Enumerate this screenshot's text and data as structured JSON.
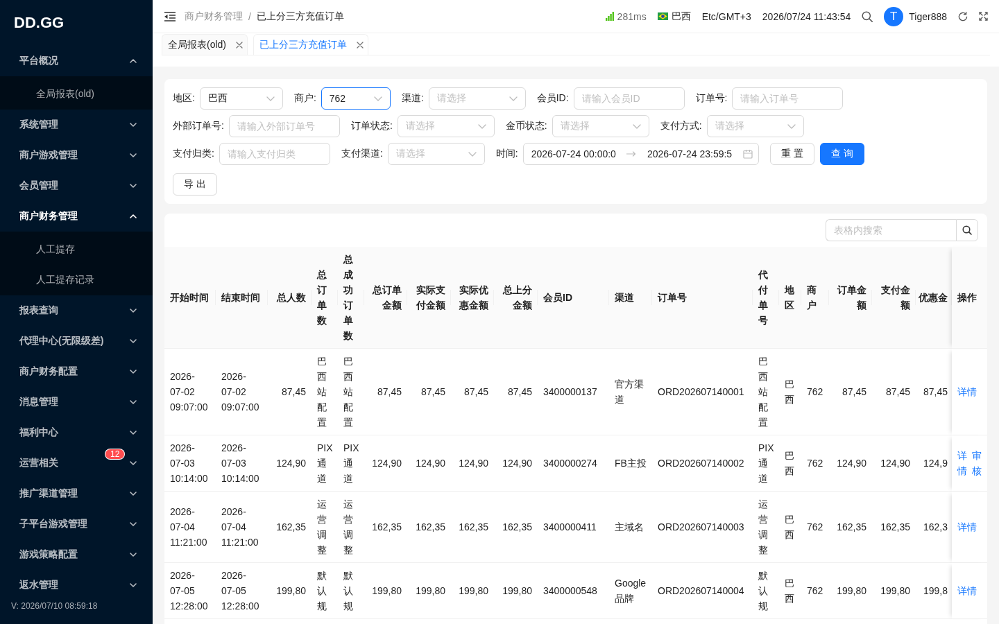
{
  "sidebar": {
    "logo": "DD.GG",
    "menu": [
      {
        "label": "平台概况",
        "expanded": true,
        "selected": false,
        "children": [
          {
            "label": "全局报表(old)",
            "selected": false
          }
        ]
      },
      {
        "label": "系统管理",
        "expanded": false,
        "selected": false
      },
      {
        "label": "商户游戏管理",
        "expanded": false,
        "selected": false
      },
      {
        "label": "会员管理",
        "expanded": false,
        "selected": false
      },
      {
        "label": "商户财务管理",
        "expanded": true,
        "selected": true,
        "children": [
          {
            "label": "人工提存",
            "selected": false
          },
          {
            "label": "人工提存记录",
            "selected": false
          }
        ]
      },
      {
        "label": "报表查询",
        "expanded": false,
        "selected": false
      },
      {
        "label": "代理中心(无限级差)",
        "expanded": false,
        "selected": false
      },
      {
        "label": "商户财务配置",
        "expanded": false,
        "selected": false
      },
      {
        "label": "消息管理",
        "expanded": false,
        "selected": false
      },
      {
        "label": "福利中心",
        "expanded": false,
        "selected": false
      },
      {
        "label": "运营相关",
        "expanded": false,
        "selected": false,
        "badge": "12"
      },
      {
        "label": "推广渠道管理",
        "expanded": false,
        "selected": false
      },
      {
        "label": "子平台游戏管理",
        "expanded": false,
        "selected": false
      },
      {
        "label": "游戏策略配置",
        "expanded": false,
        "selected": false
      },
      {
        "label": "返水管理",
        "expanded": false,
        "selected": false
      }
    ],
    "version": "V: 2026/07/10 08:59:18"
  },
  "header": {
    "breadcrumb": {
      "items": [
        "商户财务管理",
        "已上分三方充值订单"
      ],
      "separator": "/"
    },
    "latency": "281ms",
    "region": "巴西",
    "timezone": "Etc/GMT+3",
    "datetime": "2026/07/24 11:43:54",
    "user": {
      "initial": "T",
      "name": "Tiger888"
    }
  },
  "tabs": [
    {
      "label": "全局报表(old)",
      "selected": false
    },
    {
      "label": "已上分三方充值订单",
      "selected": true
    }
  ],
  "filters": {
    "fields": [
      {
        "kind": "select",
        "label": "地区:",
        "value": "巴西",
        "focused": false
      },
      {
        "kind": "select",
        "label": "商户:",
        "value": "762",
        "focused": true
      },
      {
        "kind": "select",
        "label": "渠道:",
        "placeholder": "请选择",
        "focused": false
      },
      {
        "kind": "input",
        "label": "会员ID:",
        "placeholder": "请输入会员ID",
        "focused": false
      },
      {
        "kind": "input",
        "label": "订单号:",
        "placeholder": "请输入订单号",
        "focused": false
      },
      {
        "kind": "input",
        "label": "外部订单号:",
        "placeholder": "请输入外部订单号",
        "focused": false
      },
      {
        "kind": "select",
        "label": "订单状态:",
        "placeholder": "请选择",
        "focused": false
      },
      {
        "kind": "select",
        "label": "金币状态:",
        "placeholder": "请选择",
        "focused": false
      },
      {
        "kind": "select",
        "label": "支付方式:",
        "placeholder": "请选择",
        "focused": false
      },
      {
        "kind": "input",
        "label": "支付归类:",
        "placeholder": "请输入支付归类",
        "focused": false
      },
      {
        "kind": "select",
        "label": "支付渠道:",
        "placeholder": "请选择",
        "focused": false
      },
      {
        "kind": "range",
        "label": "时间:",
        "start": "2026-07-24 00:00:0",
        "end": "2026-07-24 23:59:5",
        "focused": false
      },
      {
        "kind": "button",
        "label": "重 置",
        "primary": false
      },
      {
        "kind": "button",
        "label": "查 询",
        "primary": true
      }
    ],
    "export": {
      "label": "导 出"
    }
  },
  "table": {
    "search": {
      "placeholder": "表格内搜索"
    },
    "columns": [
      {
        "label": "开始时间",
        "kind": "text"
      },
      {
        "label": "结束时间",
        "kind": "text"
      },
      {
        "label": "总人数",
        "kind": "number"
      },
      {
        "label": "总订单数",
        "kind": "text"
      },
      {
        "label": "总成功订单数",
        "kind": "text"
      },
      {
        "label": "总订单金额",
        "kind": "number"
      },
      {
        "label": "实际支付金额",
        "kind": "number"
      },
      {
        "label": "实际优惠金额",
        "kind": "number"
      },
      {
        "label": "总上分金额",
        "kind": "number"
      },
      {
        "label": "会员ID",
        "kind": "text"
      },
      {
        "label": "渠道",
        "kind": "text"
      },
      {
        "label": "订单号",
        "kind": "text"
      },
      {
        "label": "代付单号",
        "kind": "text"
      },
      {
        "label": "地区",
        "kind": "text"
      },
      {
        "label": "商户",
        "kind": "text"
      },
      {
        "label": "订单金额",
        "kind": "number"
      },
      {
        "label": "支付金额",
        "kind": "number"
      },
      {
        "label": "优惠金",
        "kind": "number"
      },
      {
        "label": "操作",
        "kind": "action"
      }
    ],
    "rows": [
      {
        "cells": [
          "2026-07-02 09:07:00",
          "2026-07-02 09:07:00",
          "87,45",
          "巴西站配置",
          "巴西站配置",
          "87,45",
          "87,45",
          "87,45",
          "87,45",
          "3400000137",
          "官方渠道",
          "ORD202607140001",
          "巴西站配置",
          "巴西",
          "762",
          "87,45",
          "87,45",
          "87,45"
        ],
        "actions": [
          "详情"
        ]
      },
      {
        "cells": [
          "2026-07-03 10:14:00",
          "2026-07-03 10:14:00",
          "124,90",
          "PIX通道",
          "PIX通道",
          "124,90",
          "124,90",
          "124,90",
          "124,90",
          "3400000274",
          "FB主投",
          "ORD202607140002",
          "PIX通道",
          "巴西",
          "762",
          "124,90",
          "124,90",
          "124,9"
        ],
        "actions": [
          "详情",
          "审核"
        ]
      },
      {
        "cells": [
          "2026-07-04 11:21:00",
          "2026-07-04 11:21:00",
          "162,35",
          "运营调整",
          "运营调整",
          "162,35",
          "162,35",
          "162,35",
          "162,35",
          "3400000411",
          "主域名",
          "ORD202607140003",
          "运营调整",
          "巴西",
          "762",
          "162,35",
          "162,35",
          "162,3"
        ],
        "actions": [
          "详情"
        ]
      },
      {
        "cells": [
          "2026-07-05 12:28:00",
          "2026-07-05 12:28:00",
          "199,80",
          "默认规",
          "默认规",
          "199,80",
          "199,80",
          "199,80",
          "199,80",
          "3400000548",
          "Google品牌",
          "ORD202607140004",
          "默认规",
          "巴西",
          "762",
          "199,80",
          "199,80",
          "199,8"
        ],
        "actions": [
          "详情"
        ]
      }
    ]
  }
}
